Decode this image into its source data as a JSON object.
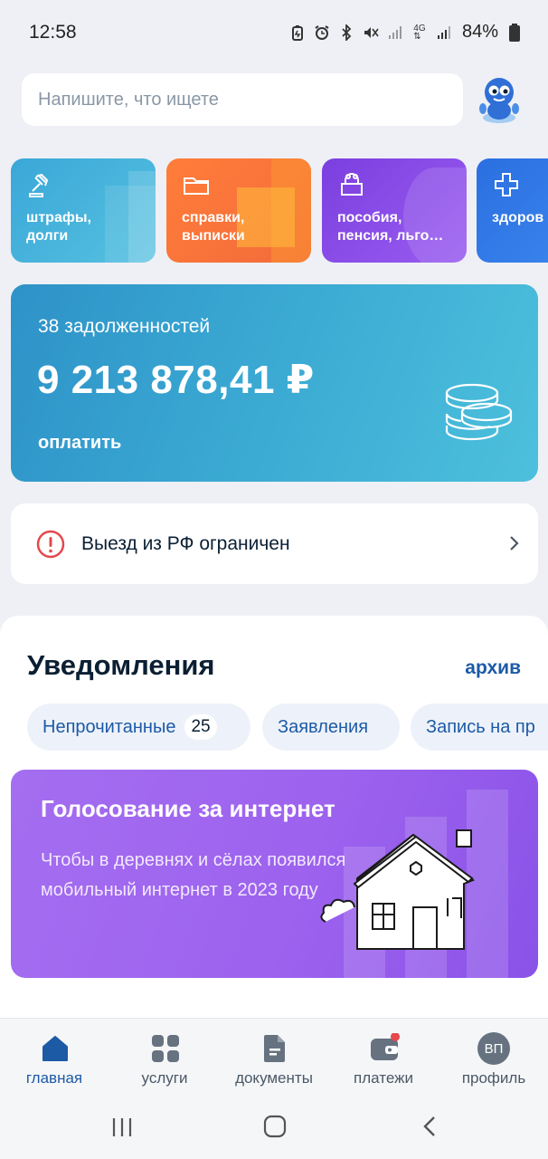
{
  "status_bar": {
    "time": "12:58",
    "battery": "84%",
    "icons": [
      "battery-saver-icon",
      "alarm-icon",
      "bluetooth-icon",
      "mute-icon",
      "signal-icon",
      "4g-icon",
      "signal-icon-2",
      "battery-icon"
    ]
  },
  "search": {
    "placeholder": "Напишите, что ищете"
  },
  "assistant": {
    "icon": "robot-assistant-icon"
  },
  "tiles": [
    {
      "label": "штрафы,\nдолги",
      "icon": "gavel-icon",
      "color": "#3aa7d8"
    },
    {
      "label": "справки,\nвыписки",
      "icon": "folder-icon",
      "color": "#ff7d3a"
    },
    {
      "label": "пособия,\nпенсия, льго…",
      "icon": "wallet-icon",
      "color": "#8a4fe6"
    },
    {
      "label": "здоров",
      "icon": "plus-icon",
      "color": "#2b6fe0"
    }
  ],
  "debt": {
    "count": "38 задолженностей",
    "amount": "9 213 878,41 ₽",
    "action": "оплатить"
  },
  "restriction": {
    "text": "Выезд из РФ ограничен"
  },
  "notifications": {
    "title": "Уведомления",
    "archive": "архив",
    "chips": [
      {
        "label": "Непрочитанные",
        "count": "25"
      },
      {
        "label": "Заявления"
      },
      {
        "label": "Запись на пр"
      }
    ],
    "promo": {
      "title": "Голосование за интернет",
      "text": "Чтобы в деревнях и сёлах появился мобильный интернет в 2023 году"
    }
  },
  "bottom_nav": {
    "items": [
      {
        "label": "главная",
        "icon": "home-icon",
        "active": true
      },
      {
        "label": "услуги",
        "icon": "grid-icon"
      },
      {
        "label": "документы",
        "icon": "document-icon"
      },
      {
        "label": "платежи",
        "icon": "wallet-icon"
      },
      {
        "label": "профиль",
        "avatar": "ВП"
      }
    ]
  },
  "colors": {
    "accent": "#1d5aa6",
    "background": "#eef0f5",
    "warning": "#e5484d"
  }
}
